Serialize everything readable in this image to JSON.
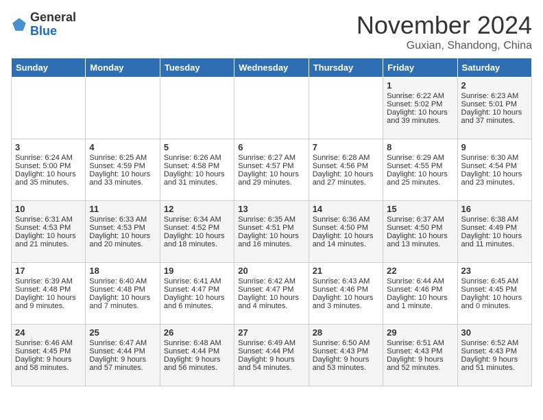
{
  "header": {
    "logo_general": "General",
    "logo_blue": "Blue",
    "month_title": "November 2024",
    "subtitle": "Guxian, Shandong, China"
  },
  "days_of_week": [
    "Sunday",
    "Monday",
    "Tuesday",
    "Wednesday",
    "Thursday",
    "Friday",
    "Saturday"
  ],
  "weeks": [
    [
      {
        "day": "",
        "sunrise": "",
        "sunset": "",
        "daylight": ""
      },
      {
        "day": "",
        "sunrise": "",
        "sunset": "",
        "daylight": ""
      },
      {
        "day": "",
        "sunrise": "",
        "sunset": "",
        "daylight": ""
      },
      {
        "day": "",
        "sunrise": "",
        "sunset": "",
        "daylight": ""
      },
      {
        "day": "",
        "sunrise": "",
        "sunset": "",
        "daylight": ""
      },
      {
        "day": "1",
        "sunrise": "Sunrise: 6:22 AM",
        "sunset": "Sunset: 5:02 PM",
        "daylight": "Daylight: 10 hours and 39 minutes."
      },
      {
        "day": "2",
        "sunrise": "Sunrise: 6:23 AM",
        "sunset": "Sunset: 5:01 PM",
        "daylight": "Daylight: 10 hours and 37 minutes."
      }
    ],
    [
      {
        "day": "3",
        "sunrise": "Sunrise: 6:24 AM",
        "sunset": "Sunset: 5:00 PM",
        "daylight": "Daylight: 10 hours and 35 minutes."
      },
      {
        "day": "4",
        "sunrise": "Sunrise: 6:25 AM",
        "sunset": "Sunset: 4:59 PM",
        "daylight": "Daylight: 10 hours and 33 minutes."
      },
      {
        "day": "5",
        "sunrise": "Sunrise: 6:26 AM",
        "sunset": "Sunset: 4:58 PM",
        "daylight": "Daylight: 10 hours and 31 minutes."
      },
      {
        "day": "6",
        "sunrise": "Sunrise: 6:27 AM",
        "sunset": "Sunset: 4:57 PM",
        "daylight": "Daylight: 10 hours and 29 minutes."
      },
      {
        "day": "7",
        "sunrise": "Sunrise: 6:28 AM",
        "sunset": "Sunset: 4:56 PM",
        "daylight": "Daylight: 10 hours and 27 minutes."
      },
      {
        "day": "8",
        "sunrise": "Sunrise: 6:29 AM",
        "sunset": "Sunset: 4:55 PM",
        "daylight": "Daylight: 10 hours and 25 minutes."
      },
      {
        "day": "9",
        "sunrise": "Sunrise: 6:30 AM",
        "sunset": "Sunset: 4:54 PM",
        "daylight": "Daylight: 10 hours and 23 minutes."
      }
    ],
    [
      {
        "day": "10",
        "sunrise": "Sunrise: 6:31 AM",
        "sunset": "Sunset: 4:53 PM",
        "daylight": "Daylight: 10 hours and 21 minutes."
      },
      {
        "day": "11",
        "sunrise": "Sunrise: 6:33 AM",
        "sunset": "Sunset: 4:53 PM",
        "daylight": "Daylight: 10 hours and 20 minutes."
      },
      {
        "day": "12",
        "sunrise": "Sunrise: 6:34 AM",
        "sunset": "Sunset: 4:52 PM",
        "daylight": "Daylight: 10 hours and 18 minutes."
      },
      {
        "day": "13",
        "sunrise": "Sunrise: 6:35 AM",
        "sunset": "Sunset: 4:51 PM",
        "daylight": "Daylight: 10 hours and 16 minutes."
      },
      {
        "day": "14",
        "sunrise": "Sunrise: 6:36 AM",
        "sunset": "Sunset: 4:50 PM",
        "daylight": "Daylight: 10 hours and 14 minutes."
      },
      {
        "day": "15",
        "sunrise": "Sunrise: 6:37 AM",
        "sunset": "Sunset: 4:50 PM",
        "daylight": "Daylight: 10 hours and 13 minutes."
      },
      {
        "day": "16",
        "sunrise": "Sunrise: 6:38 AM",
        "sunset": "Sunset: 4:49 PM",
        "daylight": "Daylight: 10 hours and 11 minutes."
      }
    ],
    [
      {
        "day": "17",
        "sunrise": "Sunrise: 6:39 AM",
        "sunset": "Sunset: 4:48 PM",
        "daylight": "Daylight: 10 hours and 9 minutes."
      },
      {
        "day": "18",
        "sunrise": "Sunrise: 6:40 AM",
        "sunset": "Sunset: 4:48 PM",
        "daylight": "Daylight: 10 hours and 7 minutes."
      },
      {
        "day": "19",
        "sunrise": "Sunrise: 6:41 AM",
        "sunset": "Sunset: 4:47 PM",
        "daylight": "Daylight: 10 hours and 6 minutes."
      },
      {
        "day": "20",
        "sunrise": "Sunrise: 6:42 AM",
        "sunset": "Sunset: 4:47 PM",
        "daylight": "Daylight: 10 hours and 4 minutes."
      },
      {
        "day": "21",
        "sunrise": "Sunrise: 6:43 AM",
        "sunset": "Sunset: 4:46 PM",
        "daylight": "Daylight: 10 hours and 3 minutes."
      },
      {
        "day": "22",
        "sunrise": "Sunrise: 6:44 AM",
        "sunset": "Sunset: 4:46 PM",
        "daylight": "Daylight: 10 hours and 1 minute."
      },
      {
        "day": "23",
        "sunrise": "Sunrise: 6:45 AM",
        "sunset": "Sunset: 4:45 PM",
        "daylight": "Daylight: 10 hours and 0 minutes."
      }
    ],
    [
      {
        "day": "24",
        "sunrise": "Sunrise: 6:46 AM",
        "sunset": "Sunset: 4:45 PM",
        "daylight": "Daylight: 9 hours and 58 minutes."
      },
      {
        "day": "25",
        "sunrise": "Sunrise: 6:47 AM",
        "sunset": "Sunset: 4:44 PM",
        "daylight": "Daylight: 9 hours and 57 minutes."
      },
      {
        "day": "26",
        "sunrise": "Sunrise: 6:48 AM",
        "sunset": "Sunset: 4:44 PM",
        "daylight": "Daylight: 9 hours and 56 minutes."
      },
      {
        "day": "27",
        "sunrise": "Sunrise: 6:49 AM",
        "sunset": "Sunset: 4:44 PM",
        "daylight": "Daylight: 9 hours and 54 minutes."
      },
      {
        "day": "28",
        "sunrise": "Sunrise: 6:50 AM",
        "sunset": "Sunset: 4:43 PM",
        "daylight": "Daylight: 9 hours and 53 minutes."
      },
      {
        "day": "29",
        "sunrise": "Sunrise: 6:51 AM",
        "sunset": "Sunset: 4:43 PM",
        "daylight": "Daylight: 9 hours and 52 minutes."
      },
      {
        "day": "30",
        "sunrise": "Sunrise: 6:52 AM",
        "sunset": "Sunset: 4:43 PM",
        "daylight": "Daylight: 9 hours and 51 minutes."
      }
    ]
  ]
}
